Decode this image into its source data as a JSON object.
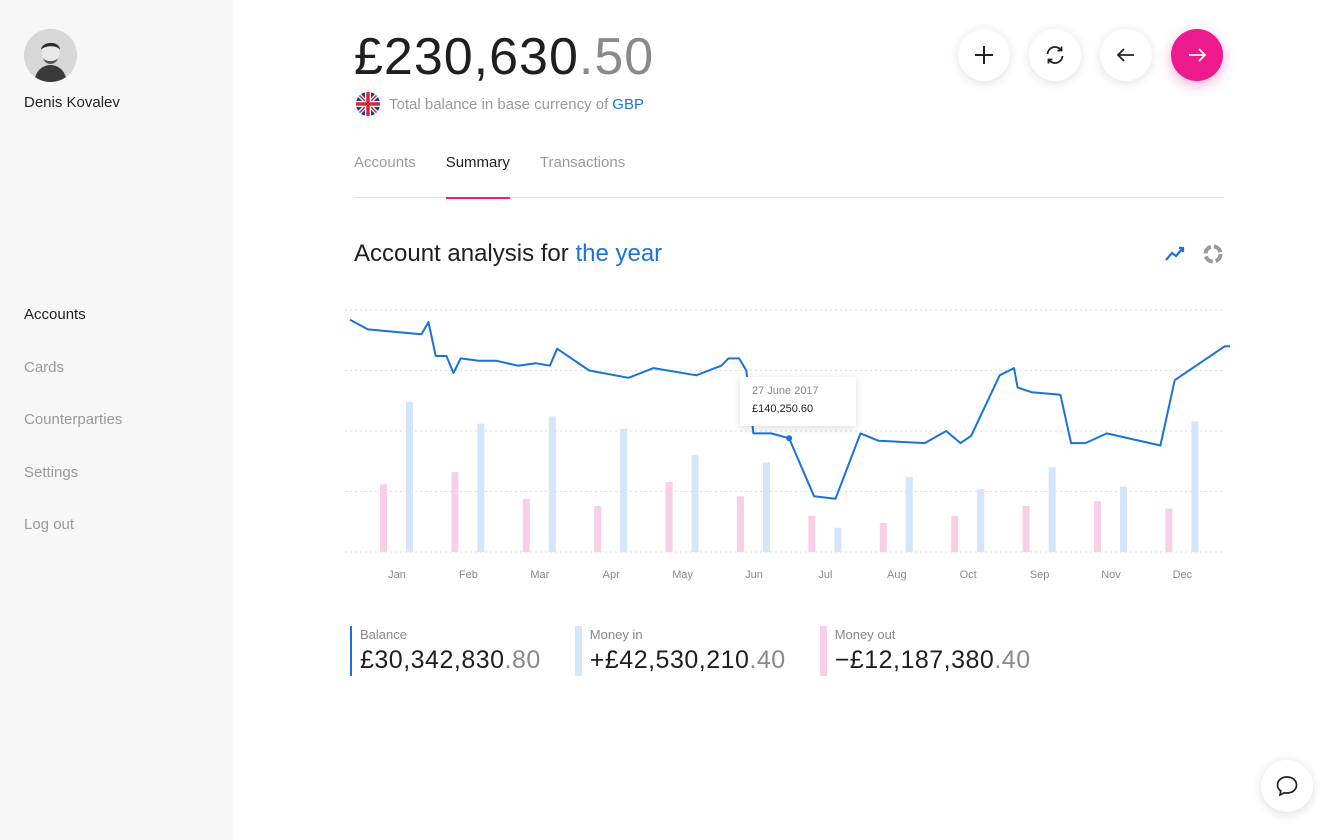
{
  "user": {
    "name": "Denis Kovalev"
  },
  "sidebar": {
    "items": [
      {
        "label": "Accounts",
        "active": true
      },
      {
        "label": "Cards"
      },
      {
        "label": "Counterparties"
      },
      {
        "label": "Settings"
      },
      {
        "label": "Log out"
      }
    ]
  },
  "header": {
    "balance_int": "£230,630",
    "balance_dec": ".50",
    "subtitle": "Total balance in base currency of",
    "currency": "GBP",
    "actions": [
      "add-icon",
      "refresh-icon",
      "arrow-left-icon",
      "arrow-right-icon"
    ]
  },
  "tabs": [
    {
      "label": "Accounts"
    },
    {
      "label": "Summary",
      "active": true
    },
    {
      "label": "Transactions"
    }
  ],
  "analysis": {
    "title_prefix": "Account analysis for",
    "period": "the year"
  },
  "tooltip": {
    "date": "27 June 2017",
    "value": "£140,250.60"
  },
  "summary": {
    "balance": {
      "label": "Balance",
      "int": "£30,342,830",
      "dec": ".80"
    },
    "money_in": {
      "label": "Money in",
      "int": "+£42,530,210",
      "dec": ".40"
    },
    "money_out": {
      "label": "Money out",
      "int": "−£12,187,380",
      "dec": ".40"
    }
  },
  "colors": {
    "accent": "#ec1a8c",
    "blue": "#1a73d9",
    "money_in": "#d4e6fb",
    "money_out": "#f8cfe6"
  },
  "chart_data": {
    "type": "line",
    "categories": [
      "Jan",
      "Feb",
      "Mar",
      "Apr",
      "May",
      "Jun",
      "Jul",
      "Aug",
      "Oct",
      "Sep",
      "Nov",
      "Dec"
    ],
    "ylim": [
      0,
      100
    ],
    "grid": true,
    "series": [
      {
        "name": "Balance",
        "type": "line",
        "points": [
          [
            0.0,
            96
          ],
          [
            0.25,
            92
          ],
          [
            1.0,
            90
          ],
          [
            1.1,
            95
          ],
          [
            1.2,
            81
          ],
          [
            1.35,
            81
          ],
          [
            1.45,
            74
          ],
          [
            1.55,
            80
          ],
          [
            1.8,
            79
          ],
          [
            2.05,
            79
          ],
          [
            2.35,
            77
          ],
          [
            2.6,
            78
          ],
          [
            2.8,
            77
          ],
          [
            2.9,
            84
          ],
          [
            3.35,
            75
          ],
          [
            3.9,
            72
          ],
          [
            4.25,
            76
          ],
          [
            4.85,
            73
          ],
          [
            5.2,
            77
          ],
          [
            5.3,
            80
          ],
          [
            5.45,
            80
          ],
          [
            5.55,
            75
          ],
          [
            5.65,
            49
          ],
          [
            5.9,
            49
          ],
          [
            6.15,
            47
          ],
          [
            6.5,
            23
          ],
          [
            6.8,
            22
          ],
          [
            7.15,
            49
          ],
          [
            7.4,
            46
          ],
          [
            8.05,
            45
          ],
          [
            8.35,
            50
          ],
          [
            8.55,
            45
          ],
          [
            8.7,
            48
          ],
          [
            9.1,
            73
          ],
          [
            9.3,
            76
          ],
          [
            9.35,
            68
          ],
          [
            9.55,
            66
          ],
          [
            9.95,
            65
          ],
          [
            10.1,
            45
          ],
          [
            10.3,
            45
          ],
          [
            10.6,
            49
          ],
          [
            11.35,
            44
          ],
          [
            11.55,
            71
          ],
          [
            12.25,
            85
          ],
          [
            12.4,
            85
          ]
        ]
      },
      {
        "name": "Money in",
        "type": "bar",
        "values": [
          62,
          53,
          56,
          51,
          40,
          37,
          10,
          31,
          26,
          35,
          27,
          54
        ]
      },
      {
        "name": "Money out",
        "type": "bar",
        "values": [
          28,
          33,
          22,
          19,
          29,
          23,
          15,
          12,
          15,
          19,
          21,
          18
        ]
      }
    ],
    "highlight": {
      "x": 6.15,
      "y": 47
    }
  }
}
